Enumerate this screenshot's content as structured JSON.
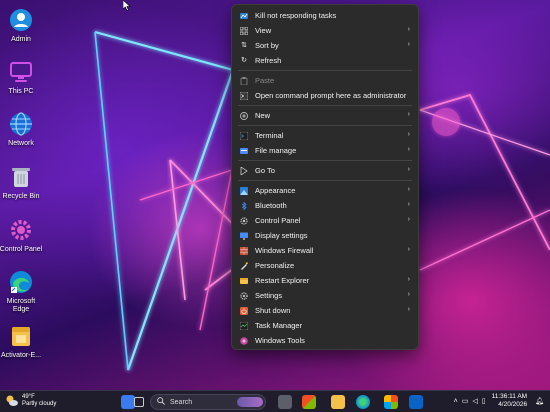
{
  "desktop": {
    "icons": [
      {
        "label": "Admin",
        "icon": "user-folder-icon"
      },
      {
        "label": "This PC",
        "icon": "monitor-icon"
      },
      {
        "label": "Network",
        "icon": "globe-icon"
      },
      {
        "label": "Recycle Bin",
        "icon": "recycle-bin-icon"
      },
      {
        "label": "Control Panel",
        "icon": "control-panel-icon"
      },
      {
        "label": "Microsoft Edge",
        "label_line1": "Microsoft",
        "label_line2": "Edge",
        "icon": "edge-icon"
      },
      {
        "label": "Activator-E...",
        "icon": "folder-icon"
      }
    ]
  },
  "context_menu": {
    "items": [
      {
        "label": "Kill not responding tasks",
        "icon": "kill-tasks-icon"
      },
      {
        "label": "View",
        "icon": "view-grid-icon",
        "submenu": true
      },
      {
        "label": "Sort by",
        "icon": "sort-icon",
        "submenu": true
      },
      {
        "label": "Refresh",
        "icon": "refresh-icon"
      },
      {
        "label": "Paste",
        "icon": "paste-icon",
        "disabled": true
      },
      {
        "label": "Open command prompt here as administrator",
        "icon": "terminal-prompt-icon"
      },
      {
        "label": "New",
        "icon": "new-plus-icon",
        "submenu": true
      },
      {
        "label": "Terminal",
        "icon": "terminal-icon",
        "submenu": true
      },
      {
        "label": "File manage",
        "icon": "file-manage-icon",
        "submenu": true
      },
      {
        "label": "Go To",
        "icon": "go-to-icon",
        "submenu": true
      },
      {
        "label": "Appearance",
        "icon": "appearance-icon",
        "submenu": true
      },
      {
        "label": "Bluetooth",
        "icon": "bluetooth-icon",
        "submenu": true
      },
      {
        "label": "Control Panel",
        "icon": "control-panel-icon",
        "submenu": true
      },
      {
        "label": "Display settings",
        "icon": "display-settings-icon"
      },
      {
        "label": "Windows Firewall",
        "icon": "firewall-icon",
        "submenu": true
      },
      {
        "label": "Personalize",
        "icon": "personalize-icon"
      },
      {
        "label": "Restart Explorer",
        "icon": "restart-explorer-icon",
        "submenu": true
      },
      {
        "label": "Settings",
        "icon": "settings-gear-icon",
        "submenu": true
      },
      {
        "label": "Shut down",
        "icon": "shut-down-icon",
        "submenu": true
      },
      {
        "label": "Task Manager",
        "icon": "task-manager-icon"
      },
      {
        "label": "Windows Tools",
        "icon": "windows-tools-icon"
      }
    ]
  },
  "taskbar": {
    "weather": {
      "temp": "49°F",
      "condition": "Partly cloudy"
    },
    "search_placeholder": "Search",
    "clock": {
      "time": "11:36:11 AM",
      "date": "4/20/2026"
    }
  },
  "colors": {
    "menu_bg": "#2b2b2b",
    "taskbar_bg": "#1f1d2b",
    "accent": "#4a8cff"
  }
}
